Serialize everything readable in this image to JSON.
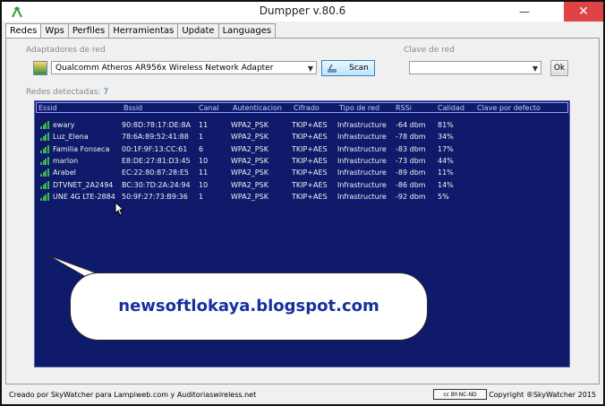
{
  "window": {
    "title": "Dumpper v.80.6",
    "minimize": "—",
    "close": "✕"
  },
  "tabs": [
    "Redes",
    "Wps",
    "Perfiles",
    "Herramientas",
    "Update",
    "Languages"
  ],
  "adapter": {
    "label": "Adaptadores de red",
    "selected": "Qualcomm Atheros AR956x Wireless Network Adapter",
    "scan_label": "Scan"
  },
  "key": {
    "label": "Clave de red",
    "selected": "",
    "ok_label": "Ok"
  },
  "networks": {
    "label": "Redes detectadas:",
    "count": "7",
    "columns": [
      "Essid",
      "Bssid",
      "Canal",
      "Autenticacion",
      "Cifrado",
      "Tipo de red",
      "RSSi",
      "Calidad",
      "Clave por defecto"
    ],
    "rows": [
      {
        "essid": "ewary",
        "bssid": "90:8D:78:17:DE:8A",
        "canal": "11",
        "auth": "WPA2_PSK",
        "cipher": "TKIP+AES",
        "type": "Infrastructure",
        "rssi": "-64 dbm",
        "quality": "81%",
        "default_key": ""
      },
      {
        "essid": "Luz_Elena",
        "bssid": "78:6A:89:52:41:88",
        "canal": "1",
        "auth": "WPA2_PSK",
        "cipher": "TKIP+AES",
        "type": "Infrastructure",
        "rssi": "-78 dbm",
        "quality": "34%",
        "default_key": ""
      },
      {
        "essid": "Familia Fonseca",
        "bssid": "00:1F:9F:13:CC:61",
        "canal": "6",
        "auth": "WPA2_PSK",
        "cipher": "TKIP+AES",
        "type": "Infrastructure",
        "rssi": "-83 dbm",
        "quality": "17%",
        "default_key": ""
      },
      {
        "essid": "marlon",
        "bssid": "E8:DE:27:81:D3:45",
        "canal": "10",
        "auth": "WPA2_PSK",
        "cipher": "TKIP+AES",
        "type": "Infrastructure",
        "rssi": "-73 dbm",
        "quality": "44%",
        "default_key": ""
      },
      {
        "essid": "Arabel",
        "bssid": "EC:22:80:87:28:E5",
        "canal": "11",
        "auth": "WPA2_PSK",
        "cipher": "TKIP+AES",
        "type": "Infrastructure",
        "rssi": "-89 dbm",
        "quality": "11%",
        "default_key": ""
      },
      {
        "essid": "DTVNET_2A2494",
        "bssid": "BC:30:7D:2A:24:94",
        "canal": "10",
        "auth": "WPA2_PSK",
        "cipher": "TKIP+AES",
        "type": "Infrastructure",
        "rssi": "-86 dbm",
        "quality": "14%",
        "default_key": ""
      },
      {
        "essid": "UNE 4G LTE-2884",
        "bssid": "50:9F:27:73:B9:36",
        "canal": "1",
        "auth": "WPA2_PSK",
        "cipher": "TKIP+AES",
        "type": "Infrastructure",
        "rssi": "-92 dbm",
        "quality": "5%",
        "default_key": ""
      }
    ]
  },
  "overlay": {
    "text": "newsoftlokaya.blogspot.com"
  },
  "status": {
    "left": "Creado por SkyWatcher para Lampiweb.com y Auditoriaswireless.net",
    "license": "cc BY-NC-ND",
    "right": "Copyright ®SkyWatcher 2015"
  },
  "colors": {
    "grid_bg": "#0f1a6b",
    "signal": "#39b54a",
    "overlay_text": "#1530a0"
  },
  "icons": {
    "adapter": "network-adapter-icon",
    "scan": "scan-icon",
    "signal": "signal-bars-icon"
  }
}
